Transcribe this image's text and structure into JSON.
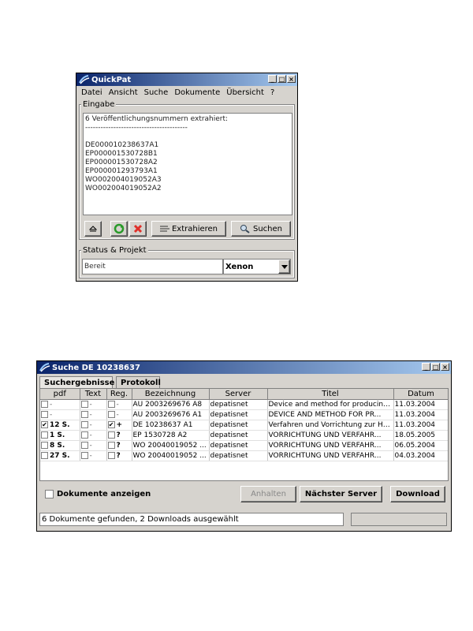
{
  "quickpat": {
    "title": "QuickPat",
    "menu": [
      "Datei",
      "Ansicht",
      "Suche",
      "Dokumente",
      "Übersicht",
      "?"
    ],
    "eingabe_label": "Eingabe",
    "lines": [
      "6 Veröffentlichungsnummern extrahiert:",
      "---------------------------------------------",
      "",
      "DE000010238637A1",
      "EP000001530728B1",
      "EP000001530728A2",
      "EP000001293793A1",
      "WO002004019052A3",
      "WO002004019052A2"
    ],
    "extract_label": "Extrahieren",
    "search_label": "Suchen",
    "status_label": "Status & Projekt",
    "status_value": "Bereit",
    "project_value": "Xenon"
  },
  "suche": {
    "title": "Suche DE 10238637",
    "tabs": [
      "Suchergebnisse",
      "Protokoll"
    ],
    "columns": [
      "pdf",
      "Text",
      "Reg.",
      "Bezeichnung",
      "Server",
      "Titel",
      "Datum"
    ],
    "rows": [
      {
        "pdf_checked": false,
        "pdf": "-",
        "text": "-",
        "reg_checked": false,
        "reg": "-",
        "bezeichnung": "AU 2003269676 A8",
        "server": "depatisnet",
        "titel": "Device and method for producing...",
        "datum": "11.03.2004"
      },
      {
        "pdf_checked": false,
        "pdf": "-",
        "text": "-",
        "reg_checked": false,
        "reg": "-",
        "bezeichnung": "AU 2003269676 A1",
        "server": "depatisnet",
        "titel": "DEVICE AND METHOD FOR PR...",
        "datum": "11.03.2004"
      },
      {
        "pdf_checked": true,
        "pdf": "12 S.",
        "text": "-",
        "reg_checked": true,
        "reg": "+",
        "bezeichnung": "DE 10238637 A1",
        "server": "depatisnet",
        "titel": "Verfahren und Vorrichtung zur He...",
        "datum": "11.03.2004"
      },
      {
        "pdf_checked": false,
        "pdf": "1 S.",
        "text": "-",
        "reg_checked": false,
        "reg": "?",
        "bezeichnung": "EP 1530728 A2",
        "server": "depatisnet",
        "titel": "VORRICHTUNG UND VERFAHR...",
        "datum": "18.05.2005"
      },
      {
        "pdf_checked": false,
        "pdf": "8 S.",
        "text": "-",
        "reg_checked": false,
        "reg": "?",
        "bezeichnung": "WO 20040019052 ...",
        "server": "depatisnet",
        "titel": "VORRICHTUNG UND VERFAHR...",
        "datum": "06.05.2004"
      },
      {
        "pdf_checked": false,
        "pdf": "27 S.",
        "text": "-",
        "reg_checked": false,
        "reg": "?",
        "bezeichnung": "WO 20040019052 ...",
        "server": "depatisnet",
        "titel": "VORRICHTUNG UND VERFAHR...",
        "datum": "04.03.2004"
      }
    ],
    "show_docs_label": "Dokumente anzeigen",
    "halt_label": "Anhalten",
    "next_server_label": "Nächster Server",
    "download_label": "Download",
    "status_text": "6 Dokumente gefunden, 2 Downloads ausgewählt"
  }
}
